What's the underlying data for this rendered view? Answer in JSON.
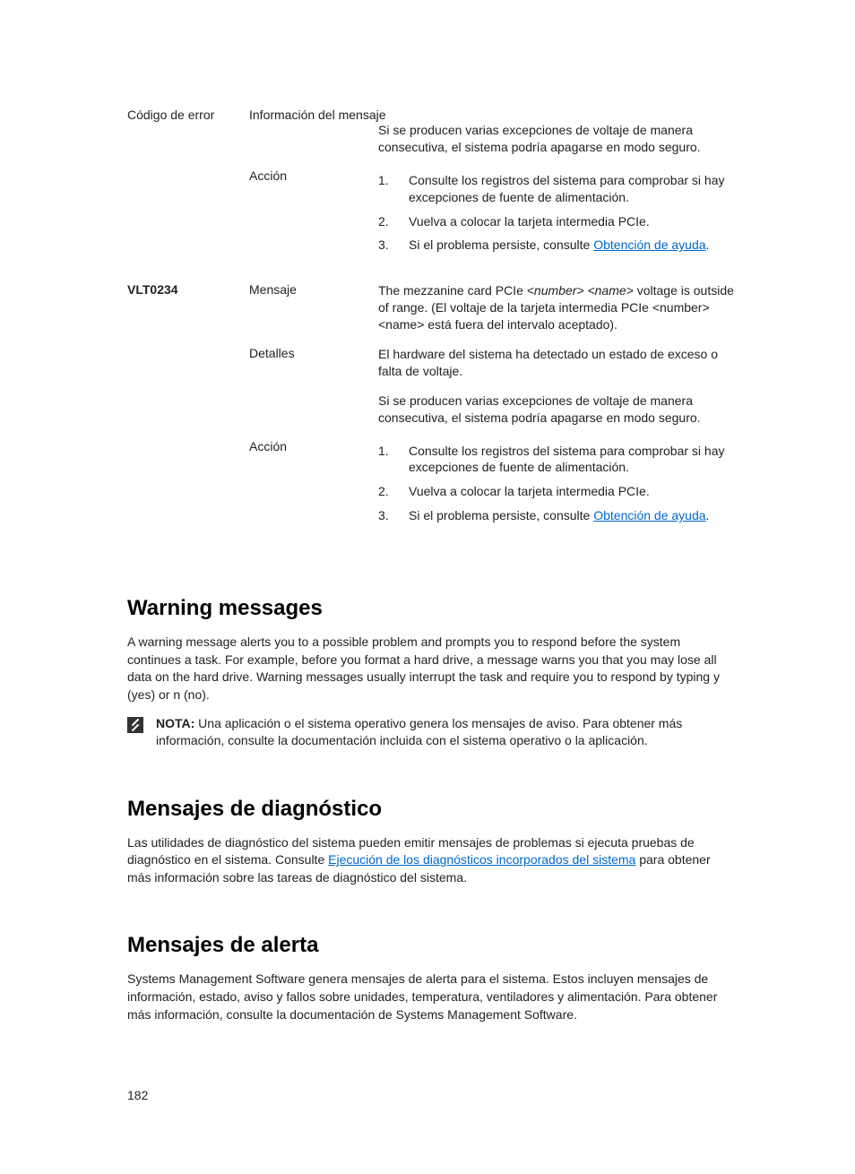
{
  "table": {
    "header_code": "Código de error",
    "header_info": "Información del mensaje",
    "row1": {
      "detail_extra": "Si se producen varias excepciones de voltaje de manera consecutiva, el sistema podría apagarse en modo seguro.",
      "accion_label": "Acción",
      "accion_1": "Consulte los registros del sistema para comprobar si hay excepciones de fuente de alimentación.",
      "accion_2": "Vuelva a colocar la tarjeta intermedia PCIe.",
      "accion_3a": "Si el problema persiste, consulte ",
      "accion_3_link": "Obtención de ayuda",
      "accion_3b": "."
    },
    "row2": {
      "code": "VLT0234",
      "mensaje_label": "Mensaje",
      "mensaje_a": "The mezzanine card PCIe ",
      "mensaje_var1": "<number>",
      "mensaje_b": " ",
      "mensaje_var2": "<name>",
      "mensaje_c": " voltage is outside of range. (El voltaje de la tarjeta intermedia PCIe <number> <name> está fuera del intervalo aceptado).",
      "detalles_label": "Detalles",
      "detalles_1": "El hardware del sistema ha detectado un estado de exceso o falta de voltaje.",
      "detalles_2": "Si se producen varias excepciones de voltaje de manera consecutiva, el sistema podría apagarse en modo seguro.",
      "accion_label": "Acción",
      "accion_1": "Consulte los registros del sistema para comprobar si hay excepciones de fuente de alimentación.",
      "accion_2": "Vuelva a colocar la tarjeta intermedia PCIe.",
      "accion_3a": "Si el problema persiste, consulte ",
      "accion_3_link": "Obtención de ayuda",
      "accion_3b": "."
    }
  },
  "warning": {
    "heading": "Warning messages",
    "body": "A warning message alerts you to a possible problem and prompts you to respond before the system continues a task. For example, before you format a hard drive, a message warns you that you may lose all data on the hard drive. Warning messages usually interrupt the task and require you to respond by typing y (yes) or n (no).",
    "note_label": "NOTA:",
    "note_text": " Una aplicación o el sistema operativo genera los mensajes de aviso. Para obtener más información, consulte la documentación incluida con el sistema operativo o la aplicación."
  },
  "diag": {
    "heading": "Mensajes de diagnóstico",
    "body_a": "Las utilidades de diagnóstico del sistema pueden emitir mensajes de problemas si ejecuta pruebas de diagnóstico en el sistema. Consulte ",
    "link": "Ejecución de los diagnósticos incorporados del sistema",
    "body_b": " para obtener más información sobre las tareas de diagnóstico del sistema."
  },
  "alerta": {
    "heading": "Mensajes de alerta",
    "body": "Systems Management Software genera mensajes de alerta para el sistema. Estos incluyen mensajes de información, estado, aviso y fallos sobre unidades, temperatura, ventiladores y alimentación. Para obtener más información, consulte la documentación de Systems Management Software."
  },
  "page_number": "182"
}
